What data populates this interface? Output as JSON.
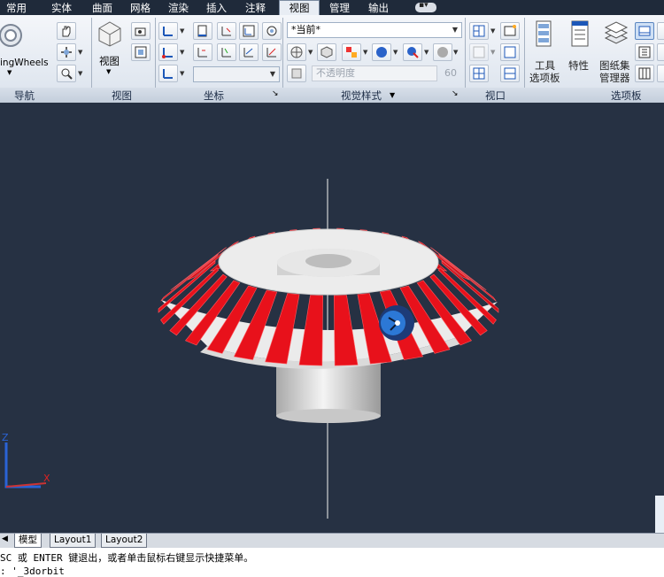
{
  "menu": {
    "tabs": [
      "常用",
      "实体",
      "曲面",
      "网格",
      "渲染",
      "插入",
      "注释",
      "视图",
      "管理",
      "输出"
    ],
    "active_index": 7
  },
  "ribbon": {
    "nav_partial_label": "ingWheels",
    "view_label": "视图",
    "visual_style_current": "*当前*",
    "opacity_label": "不透明度",
    "opacity_value": "60",
    "tool_palette_label": [
      "工具",
      "选项板"
    ],
    "properties_label": "特性",
    "sheet_set_label": [
      "图纸集",
      "管理器"
    ]
  },
  "panels": {
    "navigate": "导航",
    "view": "视图",
    "coordinates": "坐标",
    "visual_styles": "视觉样式",
    "viewports": "视口",
    "palettes": "选项板"
  },
  "layout_tabs": [
    "模型",
    "Layout1",
    "Layout2"
  ],
  "command_line": {
    "line1": "SC 或 ENTER 键退出，或者单击鼠标右键显示快捷菜单。",
    "line2": ": '_3dorbit"
  },
  "ucs": {
    "x_label": "X",
    "y_label": "Y",
    "z_label": "Z"
  },
  "colors": {
    "viewport_bg": "#263143",
    "gear_teeth": "#e8111b",
    "gear_body": "#e9e9e9",
    "orbit_cursor": "#1565c0"
  }
}
